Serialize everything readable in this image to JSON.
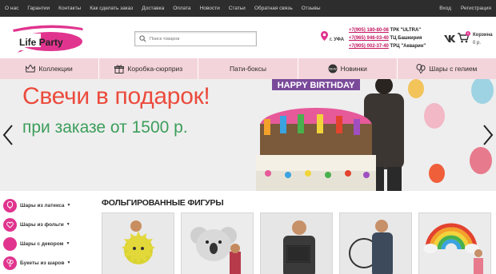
{
  "topbar": {
    "links": [
      "О нас",
      "Гарантии",
      "Контакты",
      "Как сделать заказ",
      "Доставка",
      "Оплата",
      "Новости",
      "Статьи",
      "Обратная связь",
      "Отзывы"
    ],
    "login": "Вход",
    "register": "Регистрация"
  },
  "header": {
    "logo_text": "Life Party",
    "search_placeholder": "Поиск товаров",
    "city": "г. УФА",
    "phones": [
      {
        "number": "+7(905) 180-80-08",
        "place": "ТРК \"ULTRA\""
      },
      {
        "number": "+7(965) 946-03-40",
        "place": "ТЦ Башкирия"
      },
      {
        "number": "+7(905) 002-37-40",
        "place": "ТРЦ \"Акварин\""
      }
    ],
    "cart_label": "Корзина",
    "cart_sum": "0 р.",
    "cart_count": "0"
  },
  "nav": {
    "items": [
      {
        "label": "Коллекции",
        "icon": "crown-icon"
      },
      {
        "label": "Коробка-сюрприз",
        "icon": "gift-box-icon"
      },
      {
        "label": "Пати-боксы",
        "icon": ""
      },
      {
        "label": "Новинки",
        "icon": "new-badge-icon"
      },
      {
        "label": "Шары с гелием",
        "icon": "balloons-icon"
      }
    ]
  },
  "banner": {
    "headline": "Свечи в подарок!",
    "subline": "при заказе от 1500 р.",
    "balloon_text": "HAPPY BIRTHDAY"
  },
  "sidebar": {
    "items": [
      {
        "label": "Шары из латекса",
        "icon": "latex-balloon-icon"
      },
      {
        "label": "Шары из фольги",
        "icon": "foil-heart-balloon-icon"
      },
      {
        "label": "Шары с декором",
        "icon": "decor-balloon-icon"
      },
      {
        "label": "Букеты из шаров",
        "icon": "balloon-bouquet-icon"
      }
    ]
  },
  "main": {
    "section_title": "ФОЛЬГИРОВАННЫЕ ФИГУРЫ"
  },
  "colors": {
    "accent": "#e0348e",
    "topbar": "#2d2d2d",
    "nav_bg": "#f4d4db",
    "headline": "#eb4b3c",
    "subline": "#3d9e5b"
  }
}
